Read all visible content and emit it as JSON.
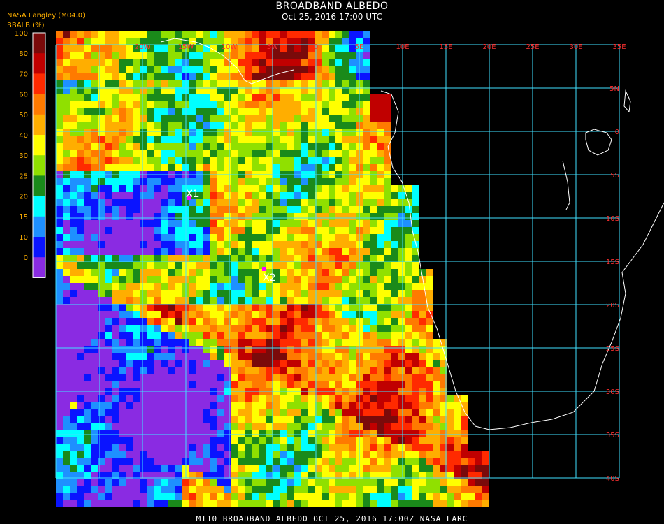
{
  "header": {
    "title": "BROADBAND ALBEDO",
    "subtitle": "Oct 25, 2016 17:00 UTC",
    "org": "NASA Langley (M04.0)",
    "unit": "BBALB (%)"
  },
  "footer": "MT10  BROADBAND ALBEDO   OCT 25, 2016 17:00Z   NASA LARC",
  "colorbar": {
    "ticks": [
      "100",
      "80",
      "70",
      "60",
      "50",
      "40",
      "30",
      "25",
      "20",
      "15",
      "10",
      "0"
    ],
    "colors": [
      "#7a0a0a",
      "#c00000",
      "#ff2a00",
      "#ff7a00",
      "#ffae00",
      "#ffff00",
      "#90e000",
      "#1a8a1a",
      "#00ffff",
      "#1e90ff",
      "#0a14ff",
      "#8a2be2"
    ]
  },
  "map": {
    "lon_labels": [
      "20W",
      "15W",
      "10W",
      "5W",
      "0",
      "5E",
      "10E",
      "15E",
      "20E",
      "25E",
      "30E",
      "35E"
    ],
    "lat_labels": [
      "5N",
      "0",
      "5S",
      "10S",
      "15S",
      "20S",
      "25S",
      "30S",
      "35S",
      "40S"
    ],
    "markers": [
      {
        "label": "X1",
        "color": "#ff00ff"
      },
      {
        "label": "X2",
        "color": "#ff00ff"
      }
    ],
    "grid_color": "#40e0ff",
    "coast_color": "#ffffff"
  }
}
